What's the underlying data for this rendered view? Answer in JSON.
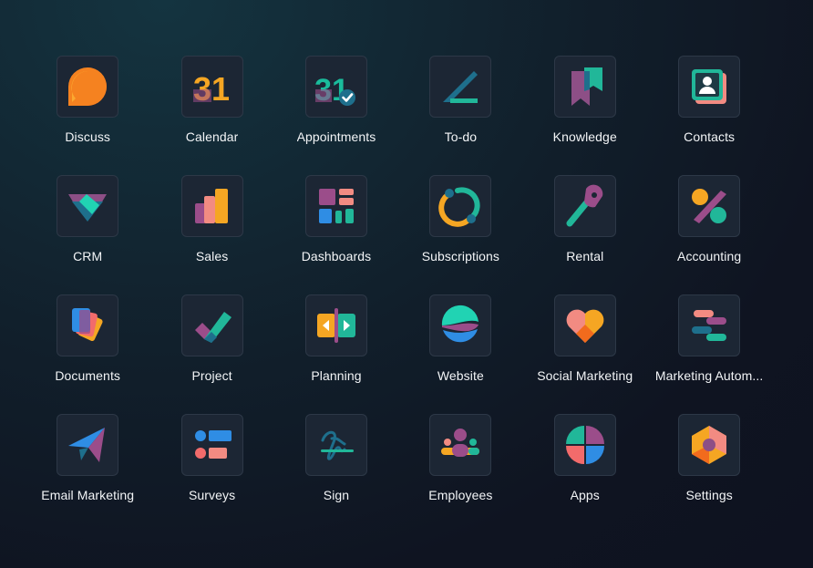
{
  "apps": [
    {
      "label": "Discuss",
      "icon": "discuss-icon"
    },
    {
      "label": "Calendar",
      "icon": "calendar-icon",
      "glyph": "31"
    },
    {
      "label": "Appointments",
      "icon": "appointments-icon",
      "glyph": "31"
    },
    {
      "label": "To-do",
      "icon": "todo-icon"
    },
    {
      "label": "Knowledge",
      "icon": "knowledge-icon"
    },
    {
      "label": "Contacts",
      "icon": "contacts-icon"
    },
    {
      "label": "CRM",
      "icon": "crm-icon"
    },
    {
      "label": "Sales",
      "icon": "sales-icon"
    },
    {
      "label": "Dashboards",
      "icon": "dashboards-icon"
    },
    {
      "label": "Subscriptions",
      "icon": "subscriptions-icon"
    },
    {
      "label": "Rental",
      "icon": "rental-icon"
    },
    {
      "label": "Accounting",
      "icon": "accounting-icon"
    },
    {
      "label": "Documents",
      "icon": "documents-icon"
    },
    {
      "label": "Project",
      "icon": "project-icon"
    },
    {
      "label": "Planning",
      "icon": "planning-icon"
    },
    {
      "label": "Website",
      "icon": "website-icon"
    },
    {
      "label": "Social Marketing",
      "icon": "social-marketing-icon"
    },
    {
      "label": "Marketing Autom...",
      "icon": "marketing-automation-icon"
    },
    {
      "label": "Email Marketing",
      "icon": "email-marketing-icon"
    },
    {
      "label": "Surveys",
      "icon": "surveys-icon"
    },
    {
      "label": "Sign",
      "icon": "sign-icon"
    },
    {
      "label": "Employees",
      "icon": "employees-icon"
    },
    {
      "label": "Apps",
      "icon": "apps-icon"
    },
    {
      "label": "Settings",
      "icon": "settings-icon"
    }
  ]
}
